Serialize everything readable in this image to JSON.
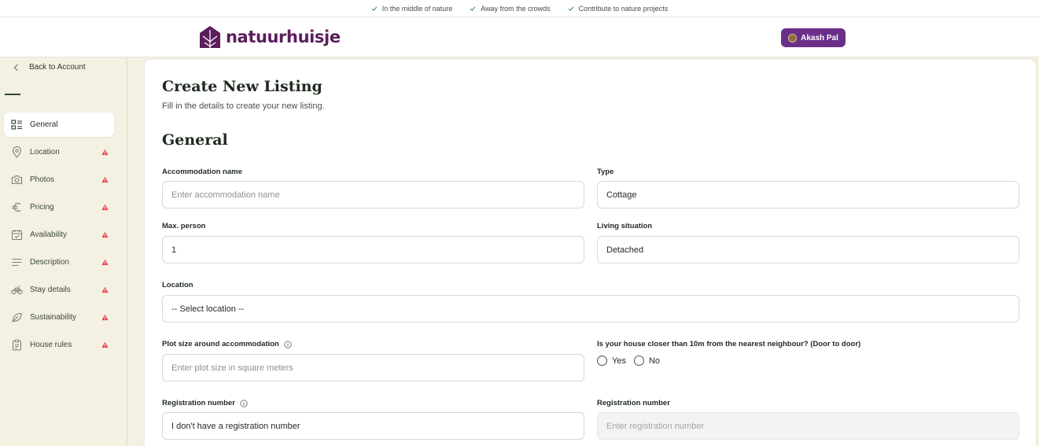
{
  "usp": [
    "In the middle of nature",
    "Away from the crowds",
    "Contribute to nature projects"
  ],
  "header": {
    "logo_text": "natuurhuisje",
    "user_name": "Akash Pal"
  },
  "sidebar": {
    "back_label": "Back to Account",
    "items": [
      {
        "label": "General",
        "icon": "layout-list-icon",
        "active": true,
        "warning": false
      },
      {
        "label": "Location",
        "icon": "map-pin-icon",
        "active": false,
        "warning": true
      },
      {
        "label": "Photos",
        "icon": "camera-icon",
        "active": false,
        "warning": true
      },
      {
        "label": "Pricing",
        "icon": "euro-icon",
        "active": false,
        "warning": true
      },
      {
        "label": "Availability",
        "icon": "calendar-check-icon",
        "active": false,
        "warning": true
      },
      {
        "label": "Description",
        "icon": "text-lines-icon",
        "active": false,
        "warning": true
      },
      {
        "label": "Stay details",
        "icon": "bicycle-icon",
        "active": false,
        "warning": true
      },
      {
        "label": "Sustainability",
        "icon": "leaf-icon",
        "active": false,
        "warning": true
      },
      {
        "label": "House rules",
        "icon": "clipboard-list-icon",
        "active": false,
        "warning": true
      }
    ]
  },
  "main": {
    "title": "Create New Listing",
    "subtitle": "Fill in the details to create your new listing.",
    "section_title": "General",
    "fields": {
      "accommodation_name": {
        "label": "Accommodation name",
        "placeholder": "Enter accommodation name",
        "value": ""
      },
      "type": {
        "label": "Type",
        "value": "Cottage"
      },
      "max_person": {
        "label": "Max. person",
        "value": "1"
      },
      "living_situation": {
        "label": "Living situation",
        "value": "Detached"
      },
      "location": {
        "label": "Location",
        "value": "-- Select location --"
      },
      "plot_size": {
        "label": "Plot size around accommodation",
        "placeholder": "Enter plot size in square meters",
        "value": ""
      },
      "neighbour_question": {
        "label": "Is your house closer than 10m from the nearest neighbour? (Door to door)",
        "options": [
          "Yes",
          "No"
        ]
      },
      "registration_choice": {
        "label": "Registration number",
        "value": "I don't have a registration number"
      },
      "registration_number": {
        "label": "Registration number",
        "placeholder": "Enter registration number",
        "disabled": true
      }
    }
  },
  "colors": {
    "brand": "#5b1d5c",
    "user_button": "#6b2f8a",
    "sidebar_bg": "#f4f1e3",
    "warning": "#e5484d",
    "check": "#3f8f4a"
  }
}
